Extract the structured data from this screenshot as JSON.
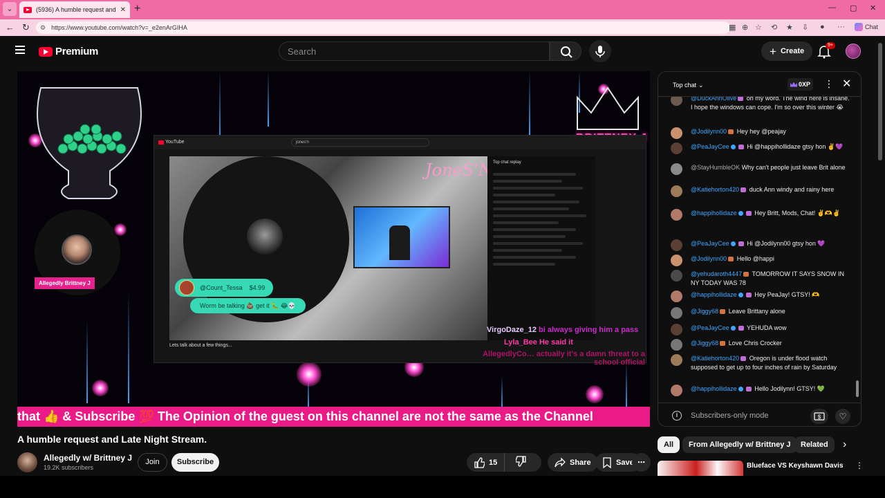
{
  "browser": {
    "tab_title": "(5936) A humble request and Late Night Stream.",
    "url": "https://www.youtube.com/watch?v=_e2enArGIHA",
    "chat_extension_label": "Chat"
  },
  "header": {
    "logo_text": "Premium",
    "search_placeholder": "Search",
    "create_label": "Create",
    "notification_count": "9+"
  },
  "player": {
    "name_tag": "Allegedly Brittney J",
    "brand_text": "BRITTNEY J",
    "inner_logo": "YouTube",
    "inner_search": "jones'n",
    "inner_watermark": "JoneS'N",
    "donation_name": "@Count_Tessa",
    "donation_amount": "$4.99",
    "donation_message": "Worm be talking 💩 get it 🐛 😂💀",
    "inner_chat_title": "Top chat replay",
    "inner_video_title": "Lets talk about a few things...",
    "overlay_chat": [
      {
        "user": "VirgoDaze_12",
        "text": "bi always giving him a pass",
        "user_color": "#e8c9ff",
        "text_color": "#c92cc9"
      },
      {
        "user": "Lyla_Bee",
        "text": "He said it",
        "user_color": "#ff3aa8",
        "text_color": "#ff3aa8"
      },
      {
        "user": "AllegedlyCo…",
        "text": "actually it's a damn threat to a school official",
        "user_color": "#b01266",
        "text_color": "#b01266"
      }
    ],
    "ticker_text": "that 👍 & Subscribe 💯 The Opinion of the guest on this channel are not the same as the Channel"
  },
  "video": {
    "title": "A humble request and Late Night Stream.",
    "channel_name": "Allegedly w/ Brittney J",
    "subscribers": "19.2K subscribers",
    "join_label": "Join",
    "subscribe_label": "Subscribe",
    "like_count": "15",
    "share_label": "Share",
    "save_label": "Save"
  },
  "chat": {
    "title": "Top chat",
    "xp": "0XP",
    "messages": [
      {
        "author": "@DuckAnnOlive",
        "text": "oh my word. The wind here is insane. I hope the windows can cope. I'm so over this winter 😭",
        "avatar": "#6b5b4e",
        "badges": [
          "star"
        ],
        "author_color": "#3ea6ff"
      },
      {
        "author": "@Jodilynn00",
        "text": "Hey hey @peajay",
        "avatar": "#c8926f",
        "badges": [
          "member"
        ],
        "author_color": "#3ea6ff"
      },
      {
        "author": "@PeaJayCee",
        "text": "Hi @happihollidaze gtsy hon ✌️💜",
        "avatar": "#5a4034",
        "badges": [
          "mod",
          "star"
        ],
        "author_color": "#3ea6ff"
      },
      {
        "author": "@StayHumbleOK",
        "text": "Why can't people just leave Brit alone",
        "avatar": "#8a8a8a",
        "badges": [],
        "author_color": "#aaaaaa"
      },
      {
        "author": "@Katiehorton420",
        "text": "duck Ann windy and rainy here",
        "avatar": "#9c7b5a",
        "badges": [
          "star"
        ],
        "author_color": "#3ea6ff"
      },
      {
        "author": "@happihollidaze",
        "text": "Hey Britt, Mods, Chat! ✌️🫶✌️",
        "avatar": "#b07a68",
        "badges": [
          "mod",
          "star"
        ],
        "author_color": "#3ea6ff"
      },
      {
        "author": "@PeaJayCee",
        "text": "Hi @Jodilynn00 gtsy hon 💜",
        "avatar": "#5a4034",
        "badges": [
          "mod",
          "star"
        ],
        "author_color": "#3ea6ff"
      },
      {
        "author": "@Jodilynn00",
        "text": "Hello @happi",
        "avatar": "#c8926f",
        "badges": [
          "member"
        ],
        "author_color": "#3ea6ff"
      },
      {
        "author": "@yehudaroth4447",
        "text": "TOMORROW IT SAYS SNOW IN NY TODAY WAS 78",
        "avatar": "#4a4a4a",
        "badges": [
          "member"
        ],
        "author_color": "#3ea6ff"
      },
      {
        "author": "@happihollidaze",
        "text": "Hey PeaJay! GTSY! 🫶",
        "avatar": "#b07a68",
        "badges": [
          "mod",
          "star"
        ],
        "author_color": "#3ea6ff"
      },
      {
        "author": "@Jiggy68",
        "text": "Leave Brittany alone",
        "avatar": "#777777",
        "badges": [
          "member"
        ],
        "author_color": "#3ea6ff"
      },
      {
        "author": "@PeaJayCee",
        "text": "YEHUDA wow",
        "avatar": "#5a4034",
        "badges": [
          "mod",
          "star"
        ],
        "author_color": "#3ea6ff"
      },
      {
        "author": "@Jiggy68",
        "text": "Love Chris Crocker",
        "avatar": "#777777",
        "badges": [
          "member"
        ],
        "author_color": "#3ea6ff"
      },
      {
        "author": "@Katiehorton420",
        "text": "Oregon is under flood watch supposed to get up to four inches of rain by Saturday",
        "avatar": "#9c7b5a",
        "badges": [
          "star"
        ],
        "author_color": "#3ea6ff"
      },
      {
        "author": "@happihollidaze",
        "text": "Hello Jodilynn! GTSY! 💚",
        "avatar": "#b07a68",
        "badges": [
          "mod",
          "star"
        ],
        "author_color": "#3ea6ff"
      }
    ],
    "footer_text": "Subscribers-only mode"
  },
  "filters": {
    "chips": [
      "All",
      "From Allegedly w/ Brittney J",
      "Related"
    ]
  },
  "recommendation": {
    "title": "Blueface VS Keyshawn Davis"
  }
}
